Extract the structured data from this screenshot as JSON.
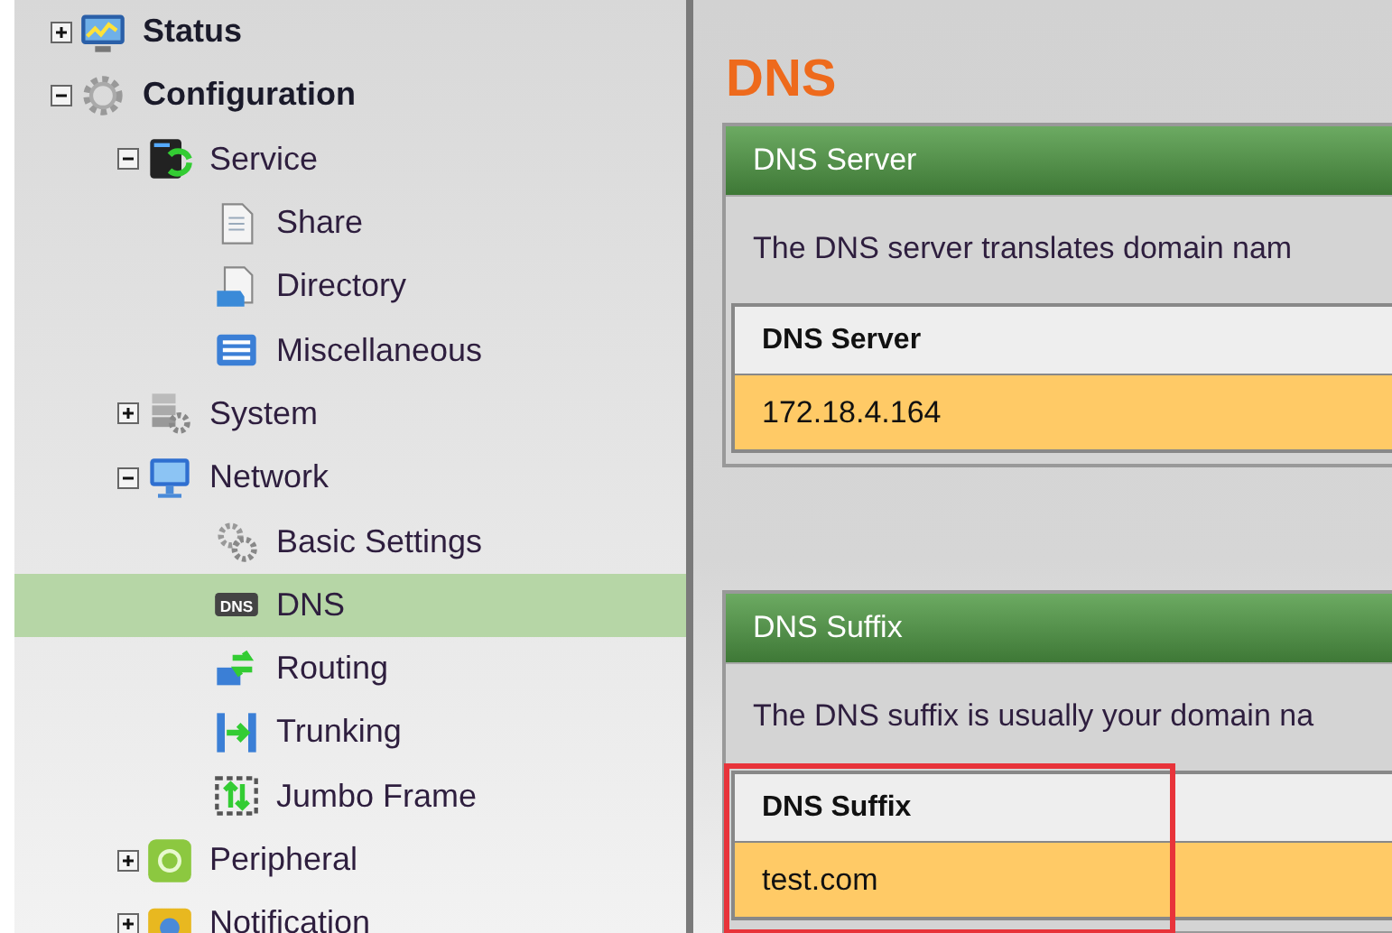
{
  "sidebar": {
    "items": [
      {
        "label": "Status",
        "expanded": false,
        "selected": false
      },
      {
        "label": "Configuration",
        "expanded": true,
        "selected": false,
        "children": [
          {
            "label": "Service",
            "expanded": true,
            "selected": false,
            "children": [
              {
                "label": "Share",
                "selected": false
              },
              {
                "label": "Directory",
                "selected": false
              },
              {
                "label": "Miscellaneous",
                "selected": false
              }
            ]
          },
          {
            "label": "System",
            "expanded": false,
            "selected": false
          },
          {
            "label": "Network",
            "expanded": true,
            "selected": false,
            "children": [
              {
                "label": "Basic Settings",
                "selected": false
              },
              {
                "label": "DNS",
                "selected": true,
                "icon_text": "DNS"
              },
              {
                "label": "Routing",
                "selected": false
              },
              {
                "label": "Trunking",
                "selected": false
              },
              {
                "label": "Jumbo Frame",
                "selected": false
              }
            ]
          },
          {
            "label": "Peripheral",
            "expanded": false,
            "selected": false
          },
          {
            "label": "Notification",
            "expanded": false,
            "selected": false
          }
        ]
      }
    ]
  },
  "page_title": "DNS",
  "panels": [
    {
      "title": "DNS Server",
      "description": "The DNS server translates domain nam",
      "table": {
        "columns": [
          "DNS Server"
        ],
        "rows": [
          [
            "172.18.4.164"
          ]
        ],
        "highlighted": false
      }
    },
    {
      "title": "DNS Suffix",
      "description": "The DNS suffix is usually your domain na",
      "table": {
        "columns": [
          "DNS Suffix"
        ],
        "rows": [
          [
            "test.com"
          ]
        ],
        "highlighted": true
      }
    }
  ]
}
